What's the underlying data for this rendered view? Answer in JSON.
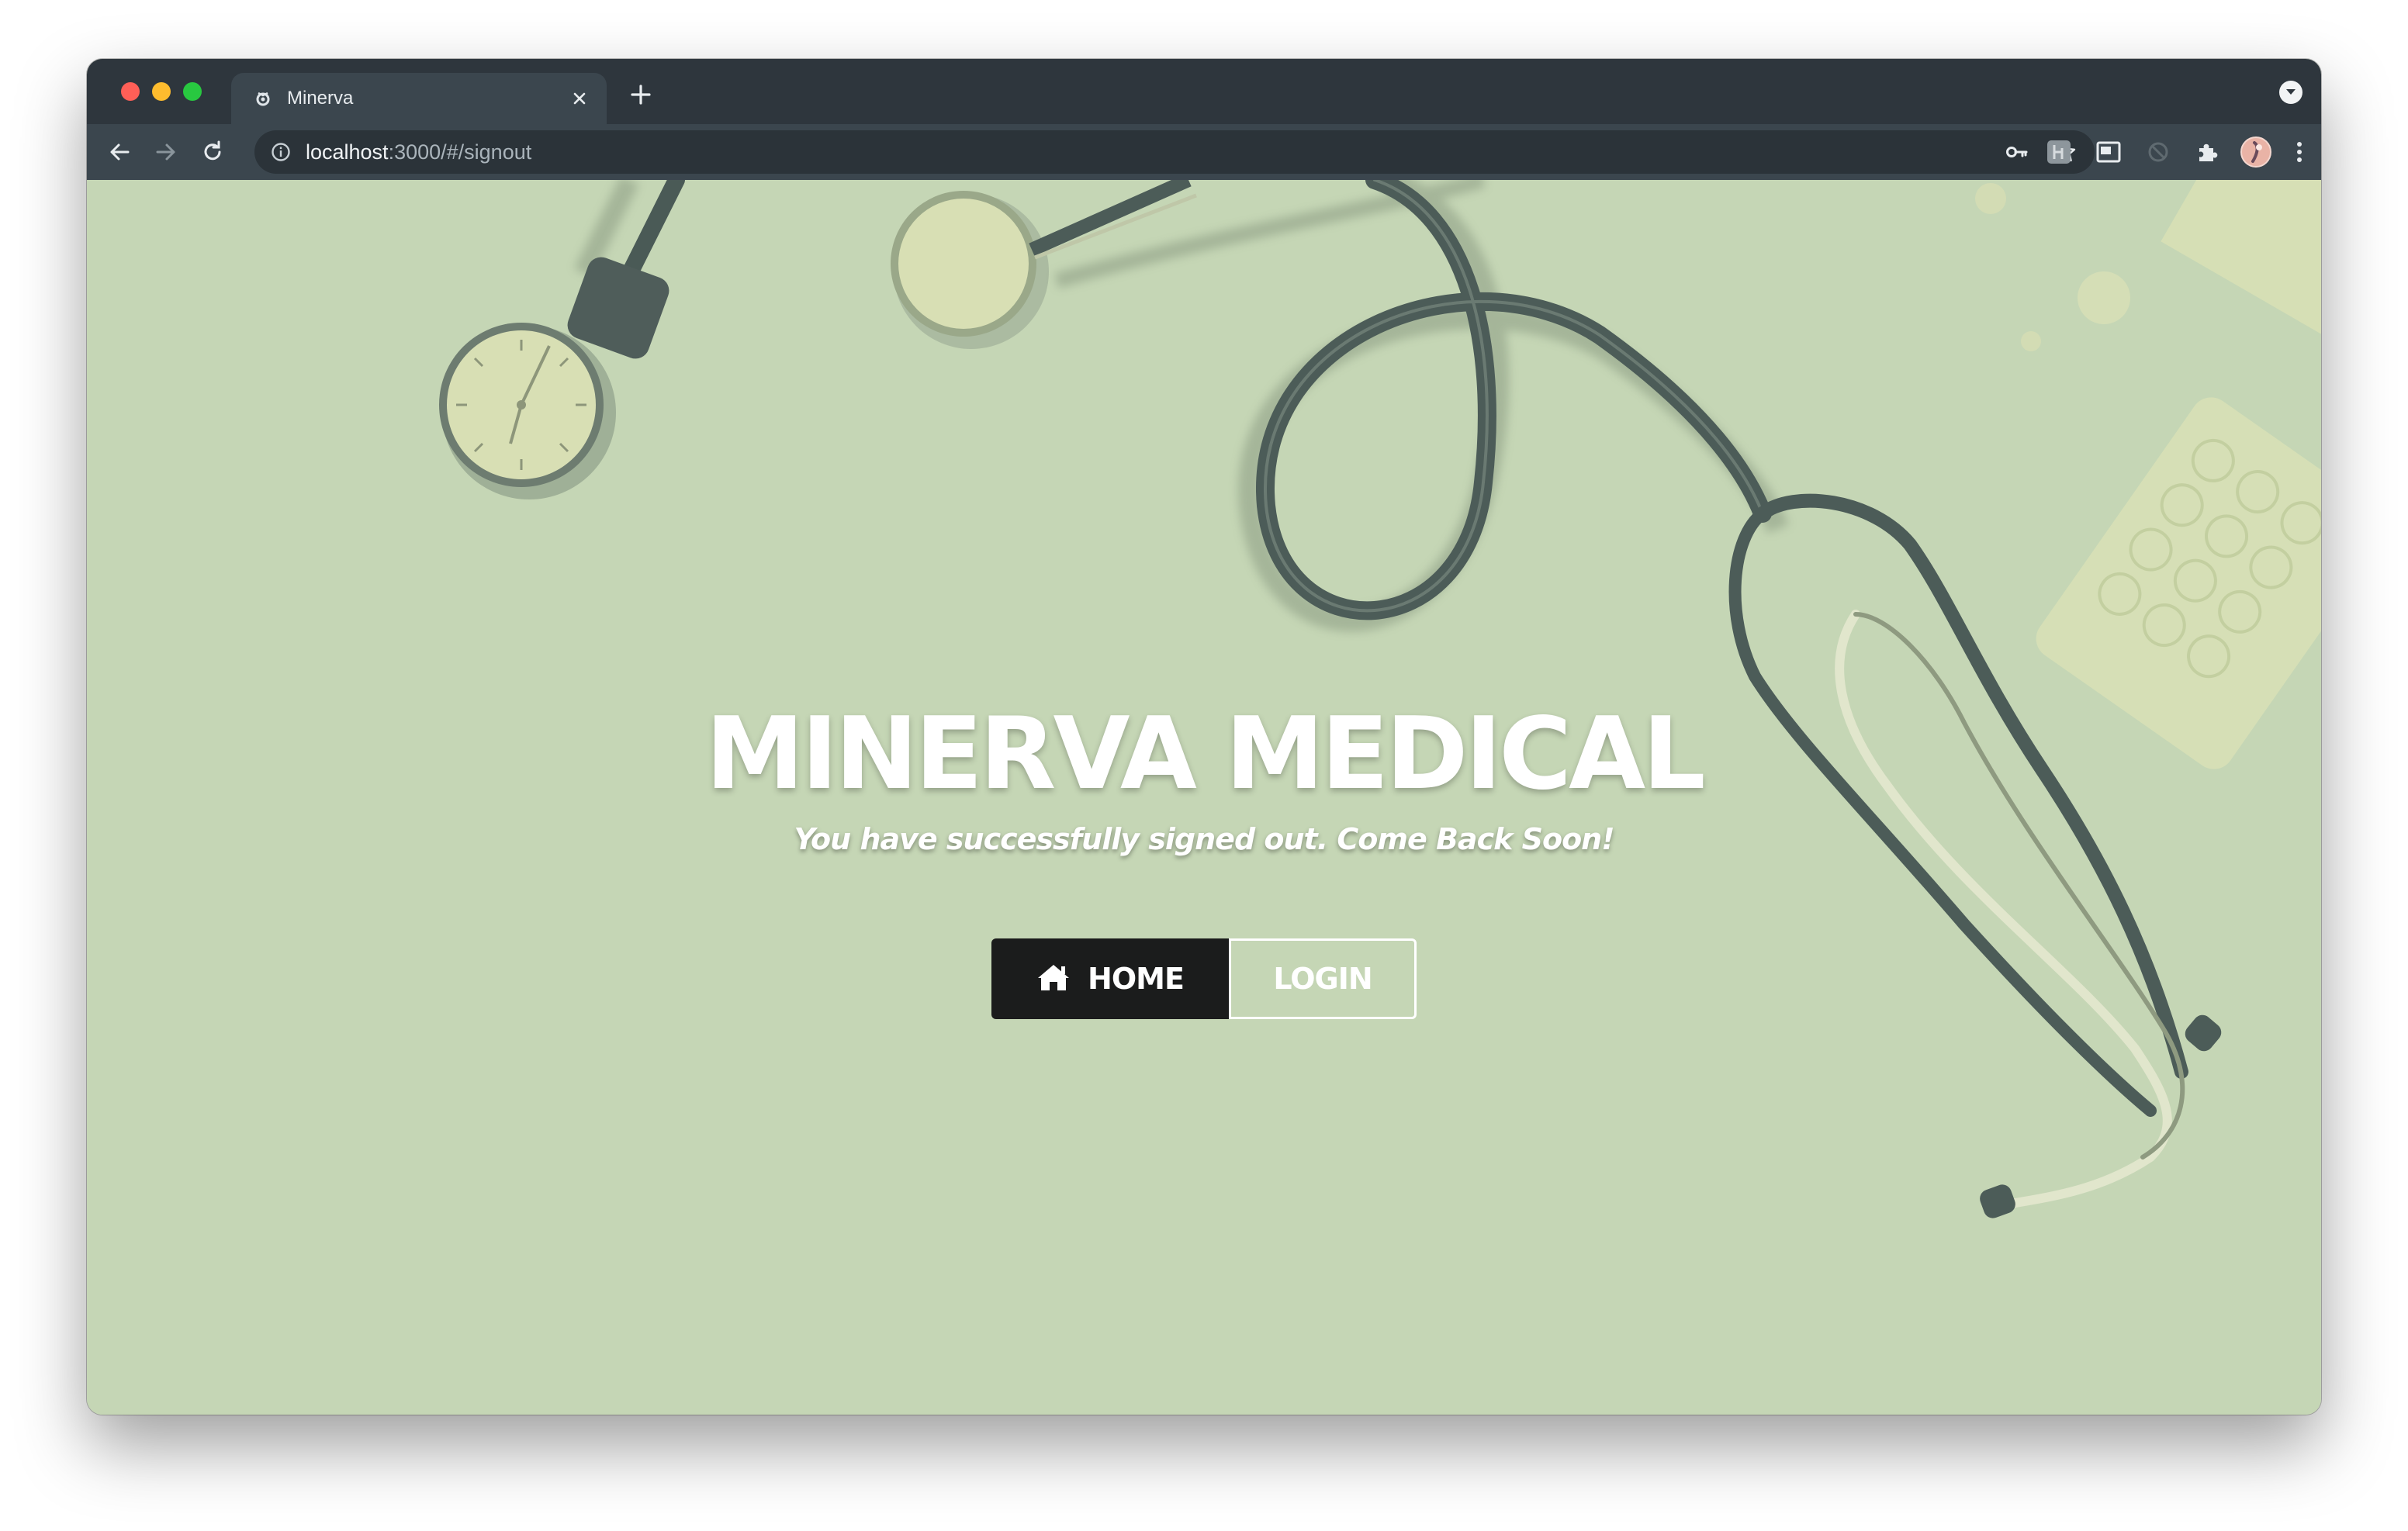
{
  "browser": {
    "tab": {
      "title": "Minerva",
      "favicon": "minerva-owl-icon"
    },
    "address_bar": {
      "host": "localhost",
      "path": ":3000/#/signout"
    },
    "icons": {
      "back": "back-arrow-icon",
      "forward": "forward-arrow-icon",
      "reload": "reload-icon",
      "site_info": "info-icon",
      "passwords": "key-icon",
      "bookmark": "star-icon",
      "extensions": "puzzle-icon",
      "menu": "kebab-menu-icon"
    }
  },
  "page": {
    "title": "MINERVA MEDICAL",
    "subtitle": "You have successfully signed out. Come Back Soon!",
    "buttons": {
      "home_label": "HOME",
      "login_label": "LOGIN"
    }
  },
  "colors": {
    "page_background": "#c5d6b5",
    "home_button": "#1b1c1c",
    "text": "#ffffff",
    "browser_chrome": "#3b464e"
  }
}
